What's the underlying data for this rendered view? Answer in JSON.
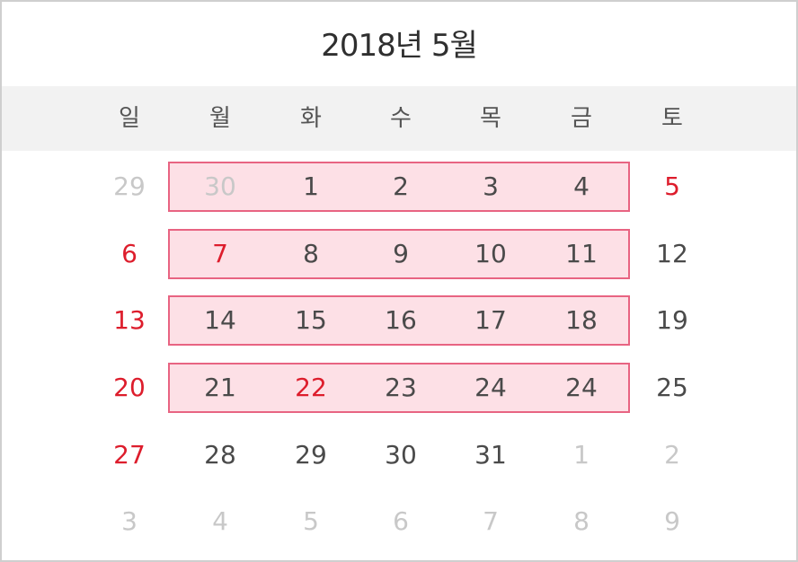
{
  "calendar": {
    "title": "2018년 5월",
    "colors": {
      "highlight_fill": "#fde0e6",
      "highlight_border": "#e86482",
      "holiday_red": "#dd1d2c",
      "muted_gray": "#c8c8c8",
      "normal_text": "#4a4a4a",
      "header_bg": "#f2f2f2"
    },
    "weekdays": [
      "일",
      "월",
      "화",
      "수",
      "목",
      "금",
      "토"
    ],
    "weeks": [
      [
        {
          "d": "29",
          "s": "muted"
        },
        {
          "d": "30",
          "s": "muted"
        },
        {
          "d": "1",
          "s": "normal"
        },
        {
          "d": "2",
          "s": "normal"
        },
        {
          "d": "3",
          "s": "normal"
        },
        {
          "d": "4",
          "s": "normal"
        },
        {
          "d": "5",
          "s": "red"
        }
      ],
      [
        {
          "d": "6",
          "s": "red"
        },
        {
          "d": "7",
          "s": "red"
        },
        {
          "d": "8",
          "s": "normal"
        },
        {
          "d": "9",
          "s": "normal"
        },
        {
          "d": "10",
          "s": "normal"
        },
        {
          "d": "11",
          "s": "normal"
        },
        {
          "d": "12",
          "s": "normal"
        }
      ],
      [
        {
          "d": "13",
          "s": "red"
        },
        {
          "d": "14",
          "s": "normal"
        },
        {
          "d": "15",
          "s": "normal"
        },
        {
          "d": "16",
          "s": "normal"
        },
        {
          "d": "17",
          "s": "normal"
        },
        {
          "d": "18",
          "s": "normal"
        },
        {
          "d": "19",
          "s": "normal"
        }
      ],
      [
        {
          "d": "20",
          "s": "red"
        },
        {
          "d": "21",
          "s": "normal"
        },
        {
          "d": "22",
          "s": "red"
        },
        {
          "d": "23",
          "s": "normal"
        },
        {
          "d": "24",
          "s": "normal"
        },
        {
          "d": "24",
          "s": "normal"
        },
        {
          "d": "25",
          "s": "normal"
        }
      ],
      [
        {
          "d": "27",
          "s": "red"
        },
        {
          "d": "28",
          "s": "normal"
        },
        {
          "d": "29",
          "s": "normal"
        },
        {
          "d": "30",
          "s": "normal"
        },
        {
          "d": "31",
          "s": "normal"
        },
        {
          "d": "1",
          "s": "muted"
        },
        {
          "d": "2",
          "s": "muted"
        }
      ],
      [
        {
          "d": "3",
          "s": "muted"
        },
        {
          "d": "4",
          "s": "muted"
        },
        {
          "d": "5",
          "s": "muted"
        },
        {
          "d": "6",
          "s": "muted"
        },
        {
          "d": "7",
          "s": "muted"
        },
        {
          "d": "8",
          "s": "muted"
        },
        {
          "d": "9",
          "s": "muted"
        }
      ]
    ],
    "highlighted_weeks": [
      0,
      1,
      2,
      3
    ]
  }
}
